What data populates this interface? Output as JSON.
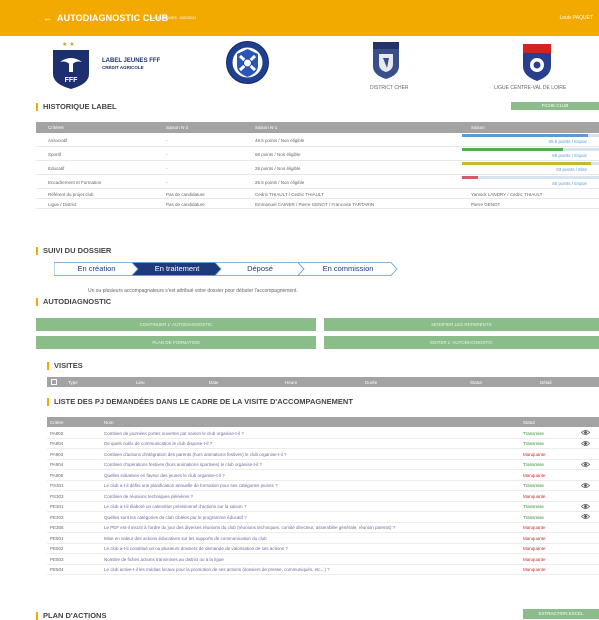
{
  "header": {
    "title": "AUTODIAGNOSTIC CLUB",
    "subtitle": "LABEL JEUNES · 2020/2021",
    "user": "Louis PAQUET",
    "back_icon": "arrow-left-icon"
  },
  "logos": {
    "label_line1": "LABEL JEUNES FFF",
    "label_line2": "CRÉDIT AGRICOLE",
    "fff_text": "FFF",
    "district": "DISTRICT CHER",
    "ligue": "LIGUE CENTRE-VAL DE LOIRE"
  },
  "historique": {
    "title": "HISTORIQUE LABEL",
    "fiche_button": "FICHE CLUB",
    "columns": [
      "Critères",
      "Saison N-2",
      "Saison N-1",
      "Saison"
    ],
    "rows": [
      {
        "critere": "Associatif",
        "n2": "-",
        "n1": "49.5 points / Non éligible",
        "saison": "55.5 points / Espoir",
        "fill_pct": 92,
        "color": "#5b9bd5"
      },
      {
        "critere": "Sportif",
        "n2": "-",
        "n1": "68 points / Non éligible",
        "saison": "69 points / Espoir",
        "fill_pct": 74,
        "color": "#4caf50"
      },
      {
        "critere": "Educatif",
        "n2": "-",
        "n1": "26 points / Non éligible",
        "saison": "93 points / Elite",
        "fill_pct": 94,
        "color": "#c9b43a"
      },
      {
        "critere": "Encadrement et Formation",
        "n2": "-",
        "n1": "26.5 points / Non éligible",
        "saison": "55 points / Espoir",
        "fill_pct": 12,
        "color": "#d05c6b"
      },
      {
        "critere": "Référent du projet club",
        "n2": "Pas de candidature",
        "n1": "Cedric THIAULT / Cedric THIAULT",
        "saison": "Yannick LANDRY / Cedric THIAULT"
      },
      {
        "critere": "Ligue / District",
        "n2": "Pas de candidature",
        "n1": "Emmanuel CAINER / Pierre GENOT / Francoise TARTARIN",
        "saison": "Pierre GENOT"
      }
    ]
  },
  "suivi": {
    "title": "SUIVI DU DOSSIER",
    "steps": [
      "En création",
      "En traitement",
      "Déposé",
      "En commission"
    ],
    "active_step": 1,
    "note": "Un ou plusieurs accompagnateurs s'est attribué votre dossier pour débuter l'accompagnement."
  },
  "autodiag": {
    "title": "AUTODIAGNOSTIC",
    "buttons": [
      "CONTINUER L' AUTODIAGNOSTIC",
      "MODIFIER LES REFERENTS",
      "PLAN DE FORMATION",
      "EDITER L' AUTODIAGNOSTIC"
    ]
  },
  "visites": {
    "title": "VISITES",
    "columns": [
      "Type",
      "Lieu",
      "Date",
      "Heure",
      "Durée",
      "Statut",
      "Détail"
    ]
  },
  "pj": {
    "title": "LISTE DES PJ DEMANDÉES DANS LE CADRE DE LA VISITE D'ACCOMPAGNEMENT",
    "columns": [
      "Critère",
      "Nom",
      "Statut"
    ],
    "rows": [
      {
        "critere": "PA802",
        "nom": "Combien de journées portes ouvertes par saison le club organise-t-il ?",
        "statut": "Transmise",
        "eye": true
      },
      {
        "critere": "PA804",
        "nom": "De quels outils de communication le club dispose-t-il ?",
        "statut": "Transmise",
        "eye": true
      },
      {
        "critere": "PA903",
        "nom": "Combien d'actions d'intégration des parents (hors animations festives) le club organise-t-il ?",
        "statut": "Manquante",
        "eye": false
      },
      {
        "critere": "PA904",
        "nom": "Combien d'opérations festives (hors animations sportives) le club organise-t-il ?",
        "statut": "Transmise",
        "eye": true
      },
      {
        "critere": "PA905",
        "nom": "Quelles initiatives en faveur des jeunes le club organise-t-il ?",
        "statut": "Manquante",
        "eye": false
      },
      {
        "critere": "PS301",
        "nom": "Le club a-t-il défini une planification annuelle de formation pour ses catégories jeunes ?",
        "statut": "Transmise",
        "eye": true
      },
      {
        "critere": "PS303",
        "nom": "Combien de réunions techniques plénières ?",
        "statut": "Manquante",
        "eye": false
      },
      {
        "critere": "PE301",
        "nom": "Le club a-t-il élaboré un calendrier prévisionnel d'actions sur la saison ?",
        "statut": "Transmise",
        "eye": true
      },
      {
        "critere": "PE303",
        "nom": "Quelles sont les catégories du club ciblées par le programme éducatif ?",
        "statut": "Transmise",
        "eye": true
      },
      {
        "critere": "PE305",
        "nom": "Le PEF est-il inscrit à l'ordre du jour des diverses réunions du club (réunions techniques, comité directeur, assemblée générale, réunion parents) ?",
        "statut": "Manquante",
        "eye": false
      },
      {
        "critere": "PE501",
        "nom": "Mise en valeur des actions éducatives sur les supports de communication du club",
        "statut": "Manquante",
        "eye": false
      },
      {
        "critere": "PE502",
        "nom": "Le club a-t-il constitué un ou plusieurs dossiers de demande de valorisation de ses actions ?",
        "statut": "Manquante",
        "eye": false
      },
      {
        "critere": "PE503",
        "nom": "Nombre de fiches actions transmises au district ou à la ligue",
        "statut": "Manquante",
        "eye": false
      },
      {
        "critere": "PE504",
        "nom": "Le club active-t-il les médias locaux pour la promotion de ses actions (dossiers de presse, communiqués, etc...) ?",
        "statut": "Manquante",
        "eye": false
      }
    ]
  },
  "plan": {
    "title": "PLAN D'ACTIONS",
    "excel_button": "EXTRACTION EXCEL"
  }
}
